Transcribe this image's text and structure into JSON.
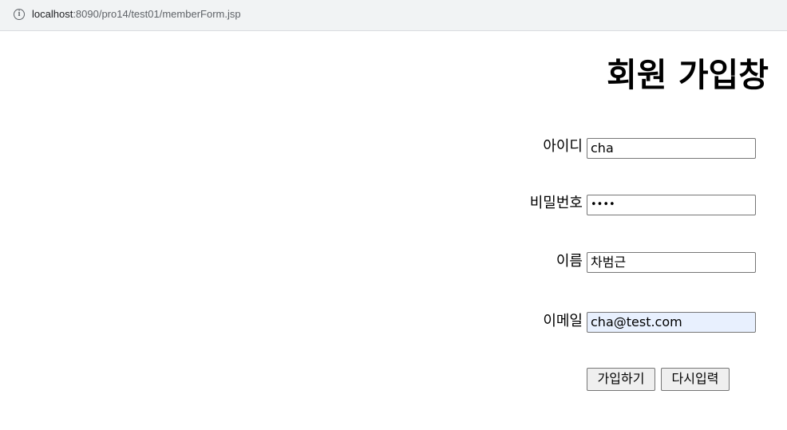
{
  "browser": {
    "url_host": "localhost",
    "url_rest": ":8090/pro14/test01/memberForm.jsp",
    "info_icon": "info-icon"
  },
  "form": {
    "title": "회원 가입창",
    "fields": [
      {
        "label": "아이디",
        "value": "cha",
        "type": "text"
      },
      {
        "label": "비밀번호",
        "value": "••••",
        "type": "password"
      },
      {
        "label": "이름",
        "value": "차범근",
        "type": "text"
      },
      {
        "label": "이메일",
        "value": "cha@test.com",
        "type": "email"
      }
    ],
    "submit_label": "가입하기",
    "reset_label": "다시입력"
  },
  "colors": {
    "autofill_background": "#e8f0fe",
    "button_background": "#efefef",
    "field_border": "#767676"
  }
}
